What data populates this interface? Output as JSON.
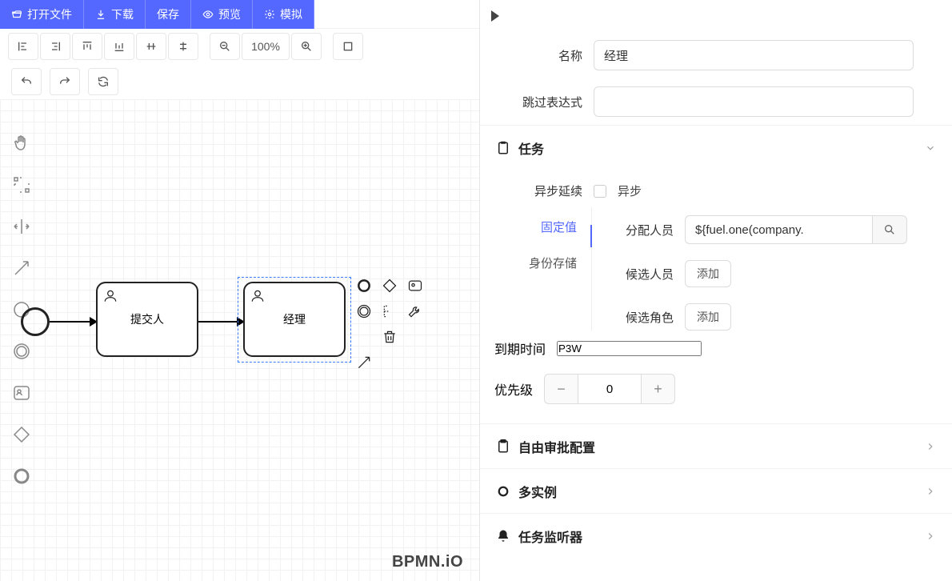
{
  "toolbar": {
    "open": "打开文件",
    "download": "下载",
    "save": "保存",
    "preview": "预览",
    "simulate": "模拟",
    "zoom_label": "100%"
  },
  "canvas": {
    "start_event": "",
    "task1_label": "提交人",
    "task2_label": "经理",
    "watermark": "BPMN.iO"
  },
  "panel": {
    "name_label": "名称",
    "name_value": "经理",
    "skip_label": "跳过表达式",
    "skip_value": "",
    "task_group": "任务",
    "async_label": "异步延续",
    "async_check_label": "异步",
    "tab_fixed": "固定值",
    "tab_identity": "身份存储",
    "assignee_label": "分配人员",
    "assignee_value": "${fuel.one(company.",
    "candidate_user_label": "候选人员",
    "candidate_role_label": "候选角色",
    "add_btn": "添加",
    "due_label": "到期时间",
    "due_value": "P3W",
    "priority_label": "优先级",
    "priority_value": "0",
    "free_approval": "自由审批配置",
    "multi_instance": "多实例",
    "task_listener": "任务监听器"
  }
}
